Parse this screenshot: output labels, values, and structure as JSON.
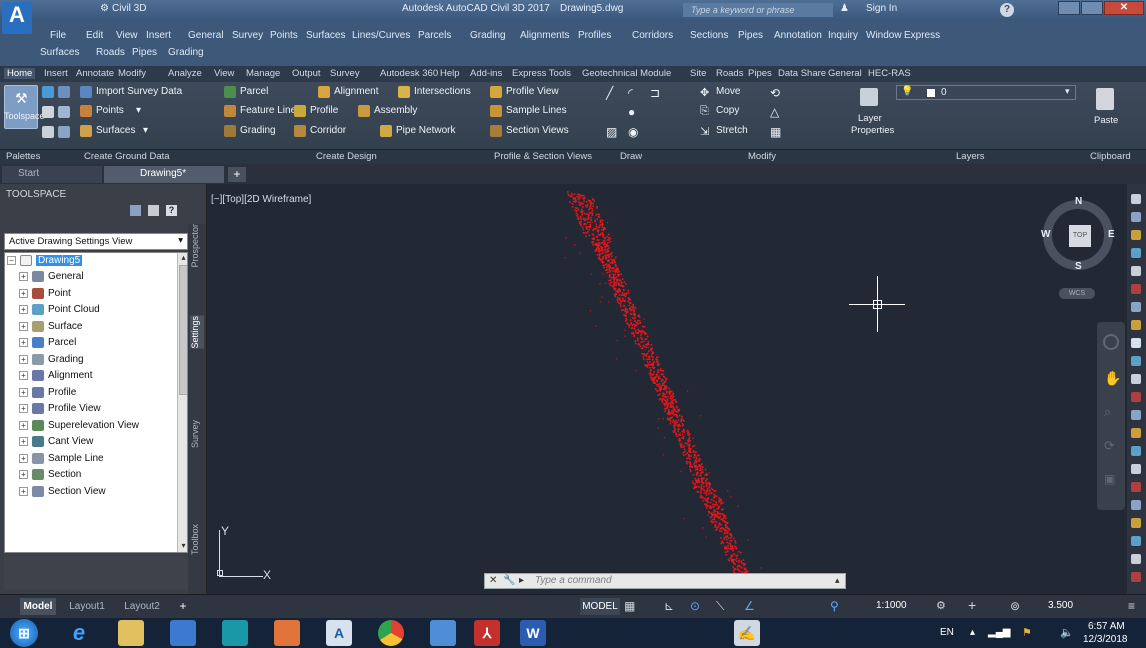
{
  "title_bar": {
    "app_title": "Autodesk AutoCAD Civil 3D 2017",
    "doc_name": "Drawing5.dwg",
    "workspace": "Civil 3D",
    "search_placeholder": "Type a keyword or phrase",
    "sign_in": "Sign In"
  },
  "menu_bar": {
    "items_row1": [
      "File",
      "Edit",
      "View",
      "Insert",
      "General",
      "Survey",
      "Points",
      "Surfaces",
      "Lines/Curves",
      "Parcels",
      "Grading",
      "Alignments",
      "Profiles",
      "Corridors",
      "Sections",
      "Pipes",
      "Annotation",
      "Inquiry",
      "Window",
      "Express"
    ],
    "items_row2": [
      "Surfaces",
      "Roads",
      "Pipes",
      "Grading"
    ]
  },
  "ribbon_tabs": [
    "Home",
    "Insert",
    "Annotate",
    "Modify",
    "Analyze",
    "View",
    "Manage",
    "Output",
    "Survey",
    "Autodesk 360",
    "Help",
    "Add-ins",
    "Express Tools",
    "Geotechnical Module",
    "Site",
    "Roads",
    "Pipes",
    "Data Share",
    "General",
    "HEC-RAS"
  ],
  "ribbon": {
    "toolspace": "Toolspace",
    "import_survey": "Import Survey Data",
    "points": "Points",
    "surfaces": "Surfaces",
    "parcel": "Parcel",
    "feature_line": "Feature Line",
    "profile": "Profile",
    "grading": "Grading",
    "corridor": "Corridor",
    "alignment": "Alignment",
    "intersections": "Intersections",
    "assembly": "Assembly",
    "pipe_network": "Pipe Network",
    "profile_view": "Profile View",
    "sample_lines": "Sample Lines",
    "section_views": "Section Views",
    "move": "Move",
    "copy": "Copy",
    "stretch": "Stretch",
    "layer_properties_1": "Layer",
    "layer_properties_2": "Properties",
    "layer_value": "0",
    "paste": "Paste"
  },
  "panel_labels": [
    "Palettes",
    "Create Ground Data",
    "Create Design",
    "Profile & Section Views",
    "Draw",
    "Modify",
    "Layers",
    "Clipboard"
  ],
  "doc_tabs": [
    "Start",
    "Drawing5*"
  ],
  "toolspace": {
    "title": "TOOLSPACE",
    "view_select": "Active Drawing Settings View",
    "root": "Drawing5",
    "items": [
      "General",
      "Point",
      "Point Cloud",
      "Surface",
      "Parcel",
      "Grading",
      "Alignment",
      "Profile",
      "Profile View",
      "Superelevation View",
      "Cant View",
      "Sample Line",
      "Section",
      "Section View"
    ],
    "side_tabs": [
      "Prospector",
      "Settings",
      "Survey",
      "Toolbox"
    ]
  },
  "viewport": {
    "label": "[−][Top][2D Wireframe]",
    "viewcube": {
      "n": "N",
      "s": "S",
      "e": "E",
      "w": "W",
      "top": "TOP",
      "wcs": "WCS"
    },
    "ucs_x": "X",
    "ucs_y": "Y"
  },
  "command_line": {
    "placeholder": "Type a command"
  },
  "layout_tabs": [
    "Model",
    "Layout1",
    "Layout2"
  ],
  "status": {
    "model": "MODEL",
    "scale": "1:1000",
    "value": "3.500"
  },
  "taskbar": {
    "lang": "EN",
    "time": "6:57 AM",
    "date": "12/3/2018"
  },
  "colors": {
    "points": "#e8161a",
    "viewport_bg": "#222834"
  }
}
